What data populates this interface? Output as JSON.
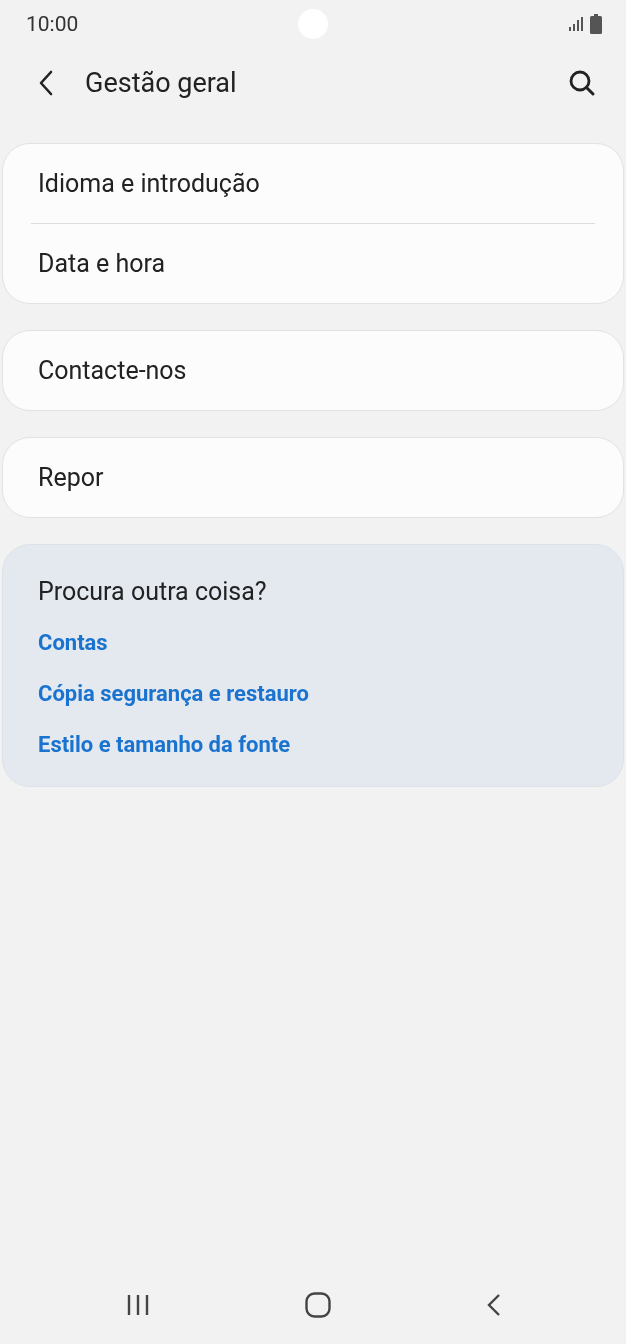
{
  "status_bar": {
    "time": "10:00"
  },
  "header": {
    "title": "Gestão geral"
  },
  "groups": [
    {
      "items": [
        "Idioma e introdução",
        "Data e hora"
      ]
    },
    {
      "items": [
        "Contacte-nos"
      ]
    },
    {
      "items": [
        "Repor"
      ]
    }
  ],
  "suggestions": {
    "title": "Procura outra coisa?",
    "links": [
      "Contas",
      "Cópia segurança e restauro",
      "Estilo e tamanho da fonte"
    ]
  }
}
